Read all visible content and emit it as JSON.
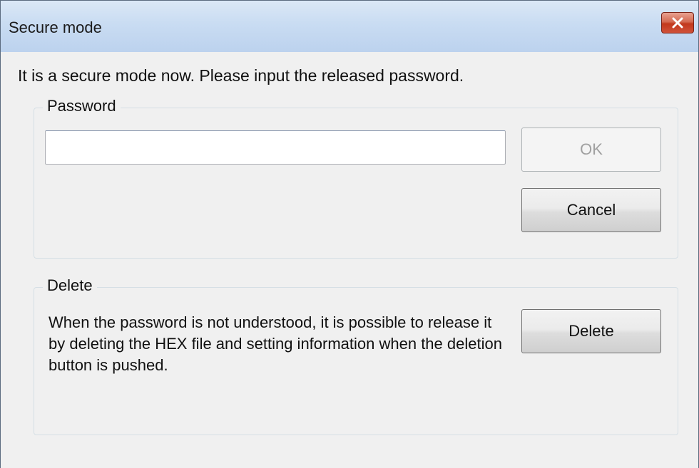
{
  "window": {
    "title": "Secure mode",
    "close_icon": "close-icon"
  },
  "message": "It is a secure mode now. Please input the released password.",
  "password_group": {
    "legend": "Password",
    "input_value": "",
    "input_placeholder": "",
    "ok_label": "OK",
    "ok_enabled": false,
    "cancel_label": "Cancel"
  },
  "delete_group": {
    "legend": "Delete",
    "description": "When the password is not understood, it is possible to release it by deleting the HEX file and setting information when the deletion button is pushed.",
    "delete_label": "Delete"
  },
  "colors": {
    "titlebar": "#c9dcf2",
    "close_button": "#c2381c",
    "dialog_background": "#f0f0f0"
  }
}
